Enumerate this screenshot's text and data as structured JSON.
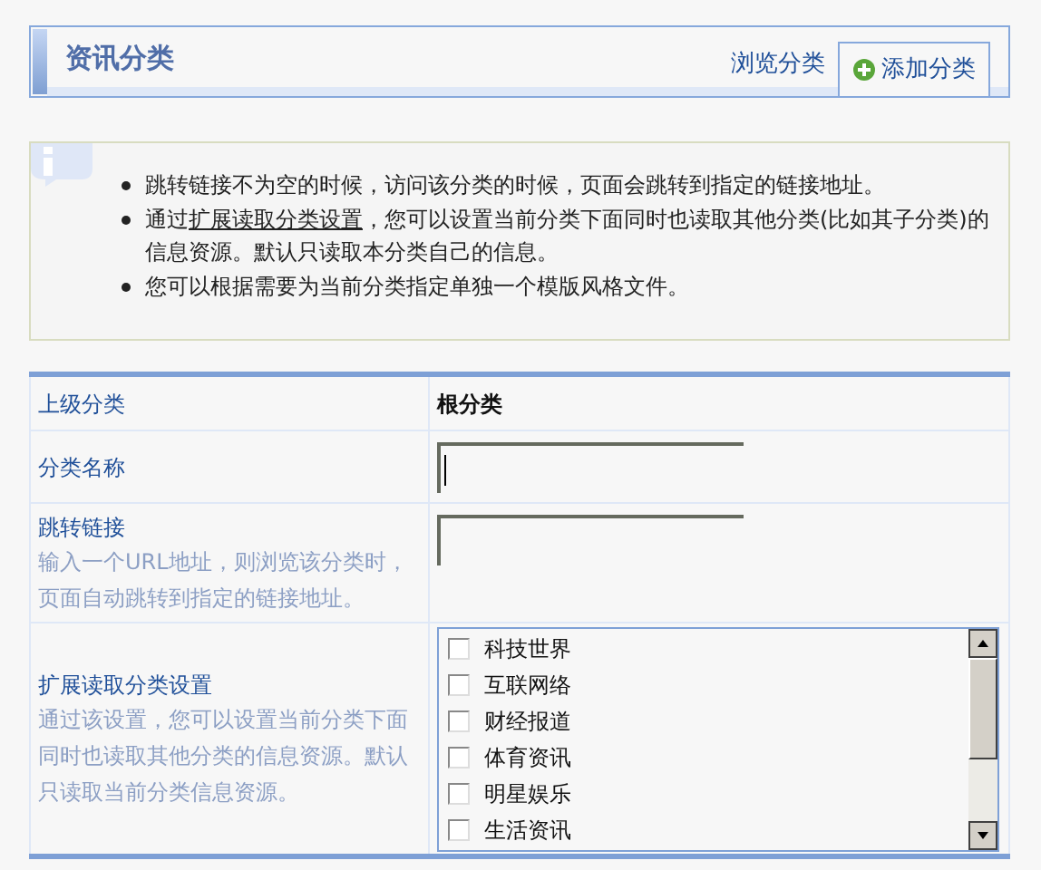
{
  "header": {
    "title": "资讯分类",
    "tabs": [
      {
        "label": "浏览分类",
        "selected": false
      },
      {
        "label": "添加分类",
        "selected": true
      }
    ]
  },
  "tips": [
    [
      {
        "text": "跳转链接不为空的时候，访问该分类的时候，页面会跳转到指定的链接地址。"
      }
    ],
    [
      {
        "text": "通过"
      },
      {
        "text": "扩展读取分类设置",
        "link": true
      },
      {
        "text": "，您可以设置当前分类下面同时也读取其他分类(比如其子分类)的信息资源。默认只读取本分类自己的信息。"
      }
    ],
    [
      {
        "text": "您可以根据需要为当前分类指定单独一个模版风格文件。"
      }
    ]
  ],
  "form": [
    {
      "kind": "static",
      "label": "上级分类",
      "value": "根分类"
    },
    {
      "kind": "input",
      "label": "分类名称",
      "focused": true
    },
    {
      "kind": "input",
      "label": "跳转链接",
      "hint": "输入一个URL地址，则浏览该分类时，页面自动跳转到指定的链接地址。",
      "focused": false
    },
    {
      "kind": "checklist",
      "label": "扩展读取分类设置",
      "hint": "通过该设置，您可以设置当前分类下面同时也读取其他分类的信息资源。默认只读取当前分类信息资源。",
      "options": [
        {
          "label": "科技世界",
          "checked": false
        },
        {
          "label": "互联网络",
          "checked": false
        },
        {
          "label": "财经报道",
          "checked": false
        },
        {
          "label": "体育资讯",
          "checked": false
        },
        {
          "label": "明星娱乐",
          "checked": false
        },
        {
          "label": "生活资讯",
          "checked": false
        }
      ]
    }
  ]
}
